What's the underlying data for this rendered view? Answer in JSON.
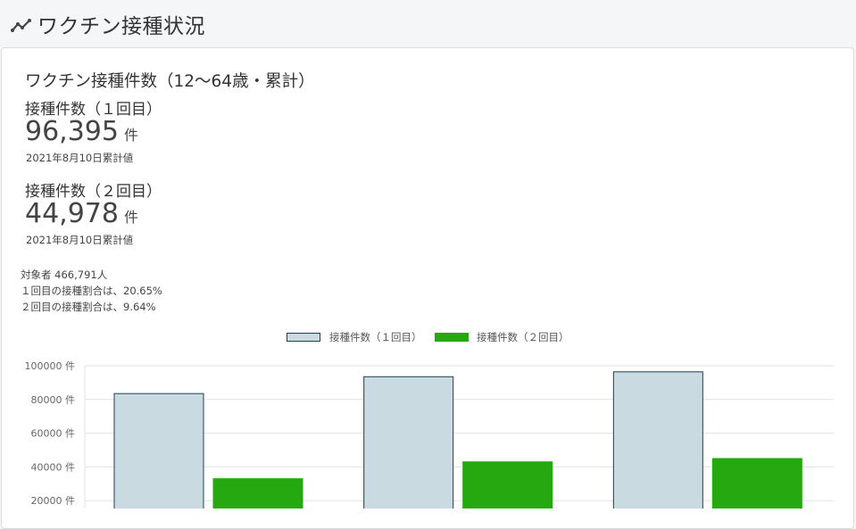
{
  "header": {
    "title": "ワクチン接種状況",
    "icon": "line-chart-icon"
  },
  "card": {
    "title": "ワクチン接種件数（12〜64歳・累計）",
    "metrics": [
      {
        "label": "接種件数（１回目）",
        "value": "96,395",
        "unit": "件",
        "date": "2021年8月10日累計値"
      },
      {
        "label": "接種件数（２回目）",
        "value": "44,978",
        "unit": "件",
        "date": "2021年8月10日累計値"
      }
    ],
    "summary": {
      "line1": "対象者 466,791人",
      "line2": "１回目の接種割合は、20.65%",
      "line3": "２回目の接種割合は、9.64%"
    }
  },
  "chart_data": {
    "type": "bar",
    "series": [
      {
        "name": "接種件数（１回目）",
        "values": [
          83500,
          93500,
          96395
        ],
        "color": "#c9dae1",
        "border": "#1f3f55"
      },
      {
        "name": "接種件数（２回目）",
        "values": [
          33000,
          43000,
          44978
        ],
        "color": "#26a910",
        "border": "#26a910"
      }
    ],
    "ylim": [
      0,
      100000
    ],
    "yticks": [
      "100000 件",
      "80000 件",
      "60000 件",
      "40000 件",
      "20000 件"
    ],
    "ytick_values": [
      100000,
      80000,
      60000,
      40000,
      20000
    ],
    "grid": true,
    "legend_position": "top-center"
  }
}
